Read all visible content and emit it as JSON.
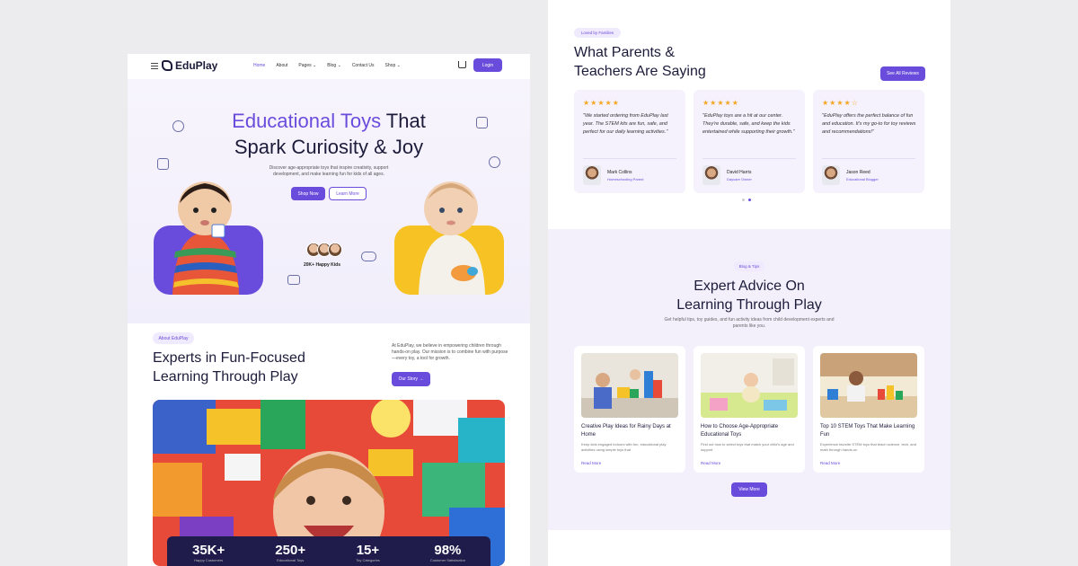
{
  "left_page": {
    "nav": {
      "logo": "EduPlay",
      "menu": [
        "Home",
        "About",
        "Pages",
        "Blog",
        "Contact Us",
        "Shop"
      ],
      "login": "Login"
    },
    "hero": {
      "title_accent": "Educational Toys",
      "title_rest_1": " That",
      "title_line2": "Spark Curiosity & Joy",
      "description": "Discover age-appropriate toys that inspire creativity, support development, and make learning fun for kids of all ages.",
      "primary_button": "Shop Now",
      "secondary_button": "Learn More",
      "happy_kids": "20K+ Happy Kids"
    },
    "about": {
      "tag": "About EduPlay",
      "title_line1": "Experts in Fun-Focused",
      "title_line2": "Learning Through Play",
      "description": "At EduPlay, we believe in empowering children through hands-on play. Our mission is to combine fun with purpose—every toy, a tool for growth.",
      "button": "Our Story →"
    },
    "stats": [
      {
        "value": "35K+",
        "label": "Happy Customers"
      },
      {
        "value": "250+",
        "label": "Educational Toys"
      },
      {
        "value": "15+",
        "label": "Toy Categories"
      },
      {
        "value": "98%",
        "label": "Customer Satisfaction"
      }
    ]
  },
  "right_page": {
    "testimonials": {
      "tag": "Loved by Families",
      "title_line1": "What Parents &",
      "title_line2": "Teachers Are Saying",
      "button": "See All Reviews",
      "cards": [
        {
          "stars": "★★★★★",
          "quote": "\"We started ordering from EduPlay last year. The STEM kits are fun, safe, and perfect for our daily learning activities.\"",
          "name": "Mark Collins",
          "role": "Homeschooling Parent"
        },
        {
          "stars": "★★★★★",
          "quote": "\"EduPlay toys are a hit at our center. They're durable, safe, and keep the kids entertained while supporting their growth.\"",
          "name": "David Harris",
          "role": "Daycare Owner"
        },
        {
          "stars": "★★★★☆",
          "quote": "\"EduPlay offers the perfect balance of fun and education. It's my go-to for toy reviews and recommendations!\"",
          "name": "Jason Reed",
          "role": "Educational Blogger"
        }
      ]
    },
    "blog": {
      "tag": "Blog & Tips",
      "title_line1": "Expert Advice On",
      "title_line2": "Learning Through Play",
      "description": "Get helpful tips, toy guides, and fun activity ideas from child development experts and parents like you.",
      "posts": [
        {
          "title": "Creative Play Ideas for Rainy Days at Home",
          "desc": "Keep kids engaged indoors with fun, educational play activities using simple toys that",
          "more": "Read More"
        },
        {
          "title": "How to Choose Age-Appropriate Educational Toys",
          "desc": "Find out how to select toys that match your child's age and support",
          "more": "Read More"
        },
        {
          "title": "Top 10 STEM Toys That Make Learning Fun",
          "desc": "Experience favorite STEM toys that teach science, tech, and math through hands-on",
          "more": "Read More"
        }
      ],
      "button": "View More"
    }
  }
}
